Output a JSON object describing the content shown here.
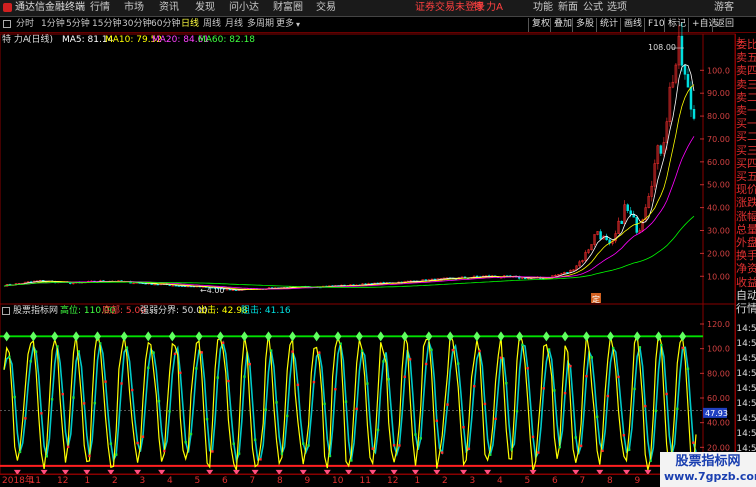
{
  "app": {
    "title": "通达信金融终端",
    "menu": [
      "行情",
      "市场",
      "资讯",
      "发现",
      "问小达",
      "财富圈",
      "交易"
    ],
    "notice": "证券交易未登录",
    "stock_label": "特 力A",
    "right_menu": [
      "功能",
      "新面",
      "公式",
      "选项",
      "游客"
    ]
  },
  "toolbar": {
    "periods": [
      "分时",
      "1分钟",
      "5分钟",
      "15分钟",
      "30分钟",
      "60分钟",
      "日线",
      "周线",
      "月线",
      "多周期",
      "更多"
    ],
    "active_period": "日线",
    "right_buttons": [
      "复权",
      "叠加",
      "多股",
      "统计",
      "画线",
      "F10",
      "标记",
      "+自选",
      "返回"
    ]
  },
  "ma_header": {
    "name": "特 力A",
    "period": "(日线)",
    "ma5": "MA5: 81.14",
    "ma10": "MA10: 79.52",
    "ma20": "MA20: 84.61",
    "ma60": "MA60: 82.18"
  },
  "indicator_header": {
    "name": "股票指标网",
    "high": "高位: 110.00",
    "low": "底部: 5.00",
    "threshold": "强弱分界: 50.00",
    "sell": "出击: 42.98",
    "resist": "阻击: 41.16"
  },
  "side_panel": {
    "label": "L",
    "items": [
      "委比",
      "卖五",
      "卖四",
      "卖三",
      "卖二",
      "卖一",
      "买一",
      "买二",
      "买三",
      "买四",
      "买五",
      "现价",
      "涨跌",
      "涨幅",
      "总量",
      "外盘",
      "换手",
      "净资",
      "收益",
      "自动",
      "行情"
    ]
  },
  "price_axis": {
    "labels": [
      "100.0",
      "90.00",
      "80.00",
      "70.00",
      "60.00",
      "50.00",
      "40.00",
      "30.00",
      "20.00",
      "10.00"
    ],
    "peak_label": "108.00",
    "low_label": "4.00",
    "marker_label": "定"
  },
  "indicator_axis": {
    "labels": [
      "120.0",
      "100.0",
      "80.00",
      "60.00",
      "40.00",
      "20.00",
      "0.00"
    ],
    "current_label": "47.93",
    "time_labels": [
      "14:5",
      "14:5",
      "14:5",
      "14:5",
      "14:5",
      "14:5",
      "14:5",
      "14:5",
      "14:5",
      "14:5"
    ]
  },
  "bottom_axis": {
    "labels": [
      "2018年",
      "11",
      "12",
      "1",
      "2",
      "3",
      "4",
      "5",
      "6",
      "7",
      "8",
      "9",
      "10",
      "11",
      "12",
      "1",
      "2",
      "3",
      "4",
      "5",
      "6",
      "7",
      "8",
      "9"
    ]
  },
  "watermark": {
    "line1": "股票指标网",
    "line2": "www.7gpzb.com"
  },
  "colors": {
    "up": "#ff3030",
    "down": "#00e0e0",
    "ma5": "#ffffff",
    "ma10": "#ffff00",
    "ma20": "#ff00ff",
    "ma60": "#00ff00",
    "yellow_line": "#ffff00",
    "cyan_line": "#00c8c8",
    "high_line": "#00e000",
    "low_line": "#ff2020"
  },
  "chart_data": [
    {
      "type": "candlestick",
      "title": "特 力A (日线)",
      "ylim": [
        4,
        108
      ],
      "series": [
        {
          "name": "MA5",
          "last": 81.14
        },
        {
          "name": "MA10",
          "last": 79.52
        },
        {
          "name": "MA20",
          "last": 84.61
        },
        {
          "name": "MA60",
          "last": 82.18
        }
      ],
      "close_path": [
        [
          0,
          6
        ],
        [
          0.05,
          8
        ],
        [
          0.1,
          7
        ],
        [
          0.15,
          8
        ],
        [
          0.2,
          7
        ],
        [
          0.25,
          6
        ],
        [
          0.3,
          5
        ],
        [
          0.33,
          4
        ],
        [
          0.4,
          5
        ],
        [
          0.5,
          6
        ],
        [
          0.6,
          8
        ],
        [
          0.7,
          10
        ],
        [
          0.78,
          9
        ],
        [
          0.82,
          12
        ],
        [
          0.84,
          18
        ],
        [
          0.86,
          30
        ],
        [
          0.88,
          22
        ],
        [
          0.9,
          40
        ],
        [
          0.92,
          30
        ],
        [
          0.94,
          55
        ],
        [
          0.955,
          70
        ],
        [
          0.97,
          100
        ],
        [
          0.98,
          108
        ],
        [
          0.99,
          90
        ],
        [
          1.0,
          80
        ]
      ]
    },
    {
      "type": "line",
      "title": "股票指标网",
      "ylim": [
        0,
        120
      ],
      "levels": {
        "high": 110,
        "low": 5,
        "threshold": 50
      },
      "series": [
        {
          "name": "出击",
          "last": 42.98
        },
        {
          "name": "阻击",
          "last": 41.16
        }
      ]
    }
  ]
}
